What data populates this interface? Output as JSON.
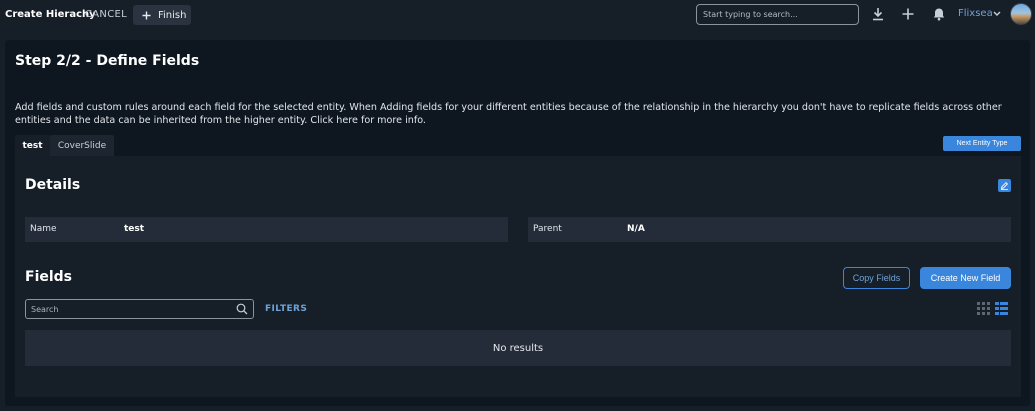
{
  "topbar": {
    "title": "Create Hierachy",
    "cancel_label": "CANCEL",
    "finish_label": "Finish",
    "search_placeholder": "Start typing to search...",
    "user_name": "Flixsea"
  },
  "page": {
    "step_title": "Step 2/2 - Define Fields",
    "description": "Add fields and custom rules around each field for the selected entity. When Adding fields for your different entities because of the relationship in the hierarchy you don't have to replicate fields across other entities and the data can be inherited from the higher entity. Click here for more info."
  },
  "tabs": [
    {
      "label": "test",
      "active": true
    },
    {
      "label": "CoverSlide",
      "active": false
    }
  ],
  "next_entity_label": "Next Entity Type",
  "details": {
    "title": "Details",
    "name_label": "Name",
    "name_value": "test",
    "parent_label": "Parent",
    "parent_value": "N/A"
  },
  "fields": {
    "title": "Fields",
    "copy_label": "Copy Fields",
    "create_label": "Create New Field",
    "search_placeholder": "Search",
    "filters_label": "FILTERS",
    "empty_text": "No results"
  },
  "colors": {
    "accent": "#3a86dd",
    "link": "#6ea3d8",
    "background": "#161e28",
    "panel": "#0e161f"
  },
  "icons": [
    "plus-icon",
    "download-icon",
    "add-icon",
    "bell-icon",
    "chevron-down-icon",
    "edit-icon",
    "search-icon",
    "grid-view-icon",
    "list-view-icon"
  ]
}
